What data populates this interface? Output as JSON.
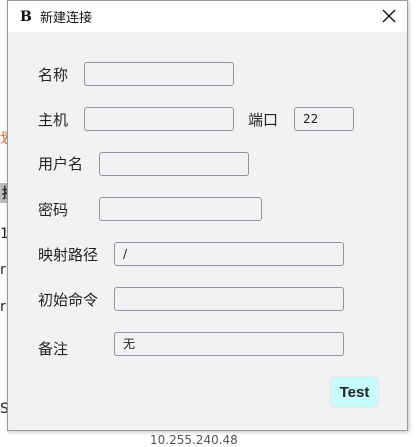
{
  "background_app": {
    "fragments": [
      "划",
      "接",
      "1",
      "r",
      "r",
      "SF"
    ],
    "bottom_text": "10.255.240.48"
  },
  "dialog": {
    "title": "新建连接",
    "app_icon_glyph": "B",
    "fields": {
      "name": {
        "label": "名称",
        "value": ""
      },
      "host": {
        "label": "主机",
        "value": ""
      },
      "port": {
        "label": "端口",
        "value": "22"
      },
      "username": {
        "label": "用户名",
        "value": ""
      },
      "password": {
        "label": "密码",
        "value": ""
      },
      "mapping_path": {
        "label": "映射路径",
        "value": "/"
      },
      "init_command": {
        "label": "初始命令",
        "value": ""
      },
      "remark": {
        "label": "备注",
        "value": "无"
      }
    },
    "test_button": "Test",
    "colors": {
      "test_button_bg": "#c8fbfd",
      "field_border": "#8a95a8",
      "dialog_bg": "#f2f2f2"
    }
  }
}
